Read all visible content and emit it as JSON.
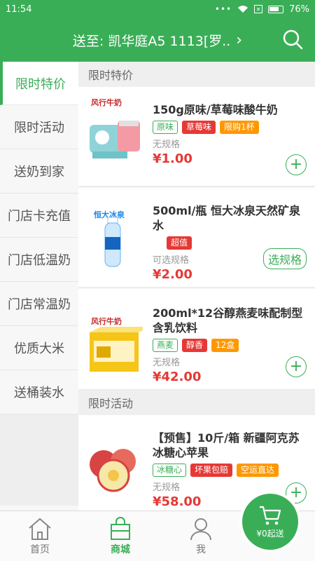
{
  "status": {
    "time": "11:54",
    "battery": "76%",
    "sim": "✕"
  },
  "header": {
    "address": "送至: 凯华庭A5 1113[罗..",
    "arrow": "›"
  },
  "sidebar": {
    "items": [
      {
        "label": "限时特价",
        "active": true
      },
      {
        "label": "限时活动"
      },
      {
        "label": "送奶到家"
      },
      {
        "label": "门店卡充值"
      },
      {
        "label": "门店低温奶"
      },
      {
        "label": "门店常温奶"
      },
      {
        "label": "优质大米"
      },
      {
        "label": "送桶装水"
      }
    ]
  },
  "sections": [
    {
      "title": "限时特价",
      "products": [
        {
          "name": "150g原味/草莓味酸牛奶",
          "tags": [
            "原味",
            "草莓味",
            "限购1杯"
          ],
          "spec": "无规格",
          "price": "¥1.00",
          "brand": "风行牛奶"
        },
        {
          "name": "500ml/瓶 恒大冰泉天然矿泉水",
          "tags": [
            "超值"
          ],
          "spec": "可选规格",
          "price": "¥2.00",
          "button": "选规格",
          "brand": "恒大冰泉"
        },
        {
          "name": "200ml*12谷醇燕麦味配制型含乳饮料",
          "tags": [
            "燕麦",
            "醇香",
            "12盒"
          ],
          "spec": "无规格",
          "price": "¥42.00",
          "brand": "风行牛奶"
        }
      ]
    },
    {
      "title": "限时活动",
      "products": [
        {
          "name": "【预售】10斤/箱 新疆阿克苏冰糖心苹果",
          "tags": [
            "冰糖心",
            "坏果包赔",
            "空运直达"
          ],
          "spec": "无规格",
          "price": "¥58.00"
        }
      ]
    }
  ],
  "nav": {
    "home": "首页",
    "mall": "商城",
    "me": "我"
  },
  "cart": {
    "label": "¥0起送"
  },
  "colors": {
    "primary": "#3aae57",
    "price": "#e53935",
    "tag_orange": "#ff9800"
  }
}
